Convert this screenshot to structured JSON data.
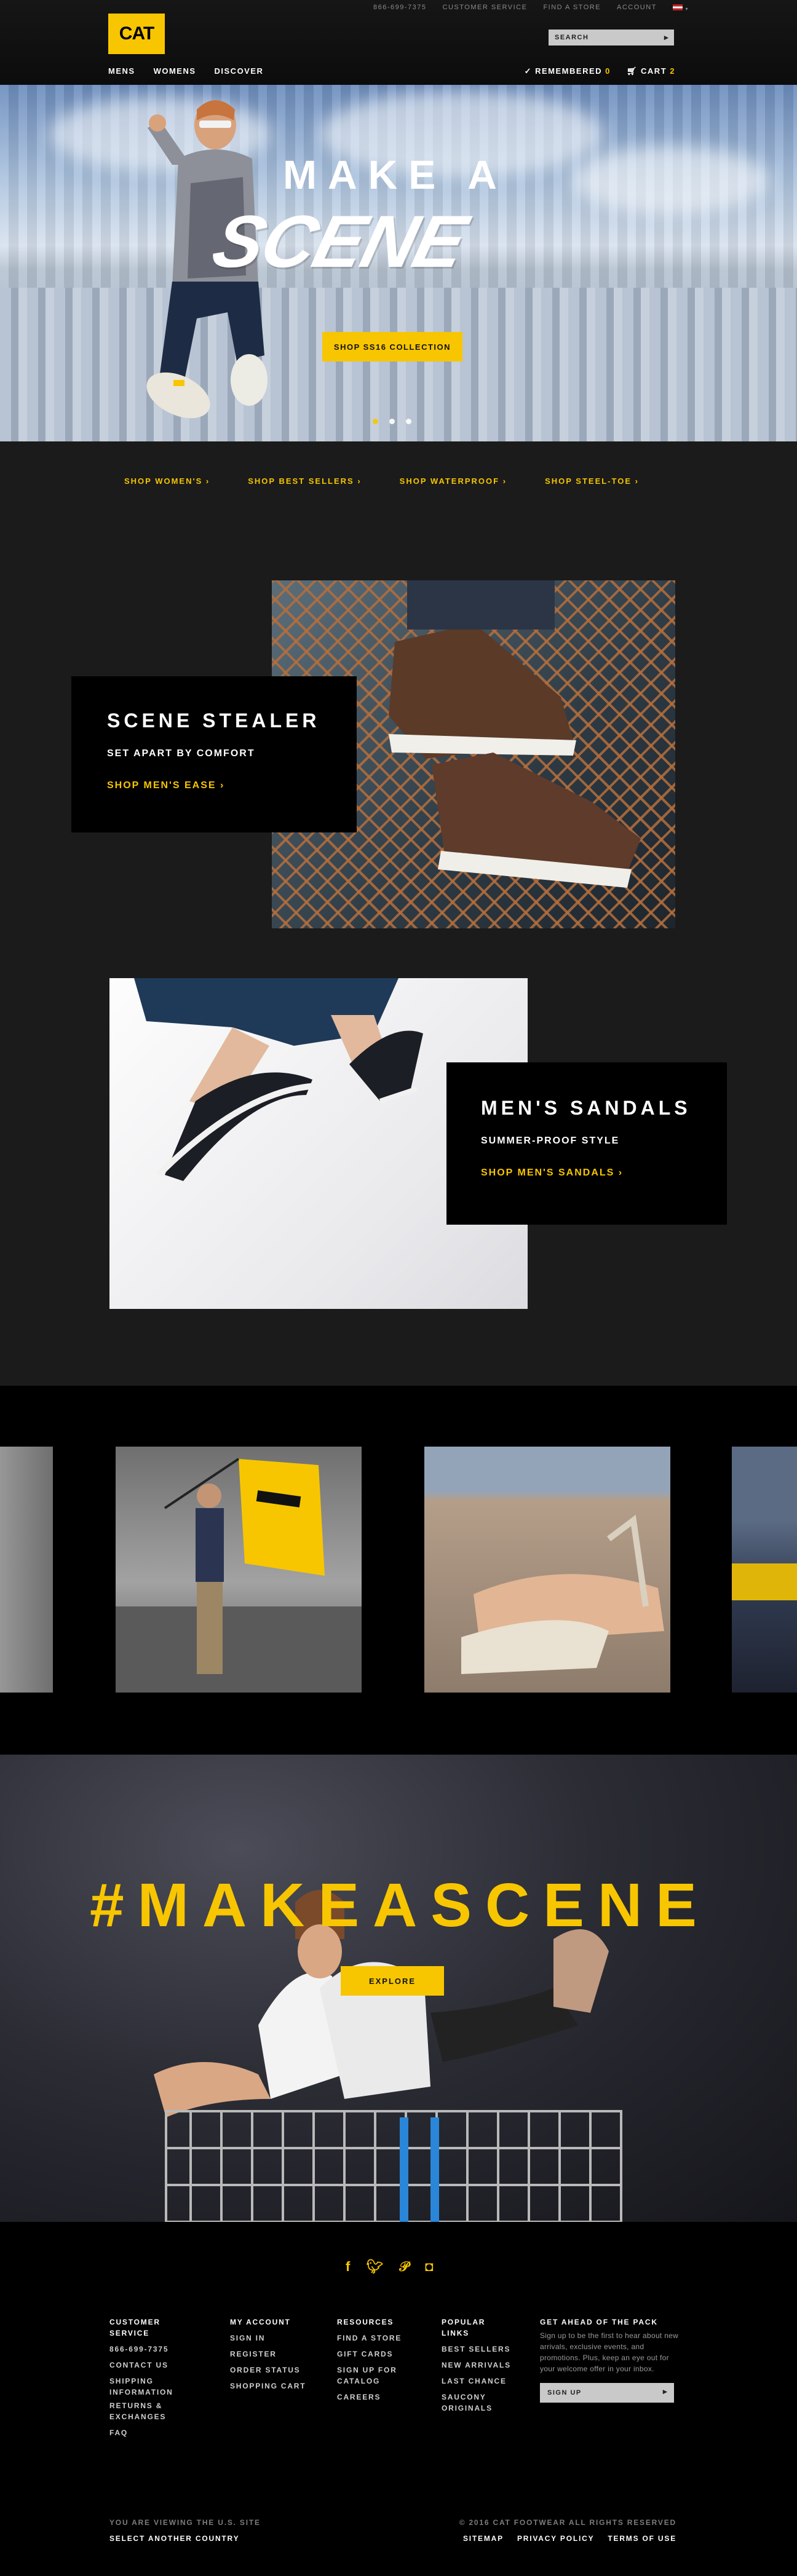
{
  "brand": {
    "logo": "CAT",
    "accent": "#f7c600"
  },
  "header": {
    "utility": [
      "866-699-7375",
      "CUSTOMER SERVICE",
      "FIND A STORE",
      "ACCOUNT"
    ],
    "search_placeholder": "SEARCH",
    "nav": [
      "MENS",
      "WOMENS",
      "DISCOVER"
    ],
    "remembered_label": "REMEMBERED",
    "remembered_count": "0",
    "cart_label": "CART",
    "cart_count": "2"
  },
  "hero": {
    "title": "MAKE A",
    "script": "SCENE",
    "cta": "SHOP SS16 COLLECTION",
    "slides": 3,
    "active_slide": 1
  },
  "quicklinks": [
    "SHOP WOMEN'S",
    "SHOP BEST SELLERS",
    "SHOP WATERPROOF",
    "SHOP STEEL-TOE"
  ],
  "features": [
    {
      "title": "SCENE STEALER",
      "subtitle": "SET APART BY COMFORT",
      "link": "SHOP MEN'S EASE"
    },
    {
      "title": "MEN'S SANDALS",
      "subtitle": "SUMMER-PROOF STYLE",
      "link": "SHOP MEN'S SANDALS"
    }
  ],
  "campaign": {
    "hashtag": "#MAKEASCENE",
    "cta": "EXPLORE"
  },
  "footer": {
    "social": [
      "facebook-icon",
      "twitter-icon",
      "pinterest-icon",
      "instagram-icon"
    ],
    "columns": [
      {
        "title": "CUSTOMER SERVICE",
        "items": [
          "866-699-7375",
          "CONTACT US",
          "SHIPPING INFORMATION",
          "RETURNS & EXCHANGES",
          "FAQ"
        ]
      },
      {
        "title": "MY ACCOUNT",
        "items": [
          "SIGN IN",
          "REGISTER",
          "ORDER STATUS",
          "SHOPPING CART"
        ]
      },
      {
        "title": "RESOURCES",
        "items": [
          "FIND A STORE",
          "GIFT CARDS",
          "SIGN UP FOR CATALOG",
          "CAREERS"
        ]
      },
      {
        "title": "POPULAR LINKS",
        "items": [
          "BEST SELLERS",
          "NEW ARRIVALS",
          "LAST CHANCE",
          "SAUCONY ORIGINALS"
        ]
      }
    ],
    "signup": {
      "title": "GET AHEAD OF THE PACK",
      "text": "Sign up to be the first to hear about new arrivals, exclusive events, and promotions. Plus, keep an eye out for your welcome offer in your inbox.",
      "button": "SIGN UP"
    },
    "site_note": "YOU ARE VIEWING THE U.S. SITE",
    "country": "SELECT ANOTHER COUNTRY",
    "copyright": "© 2016 CAT FOOTWEAR ALL RIGHTS RESERVED",
    "legal": [
      "SITEMAP",
      "PRIVACY POLICY",
      "TERMS OF USE"
    ]
  }
}
